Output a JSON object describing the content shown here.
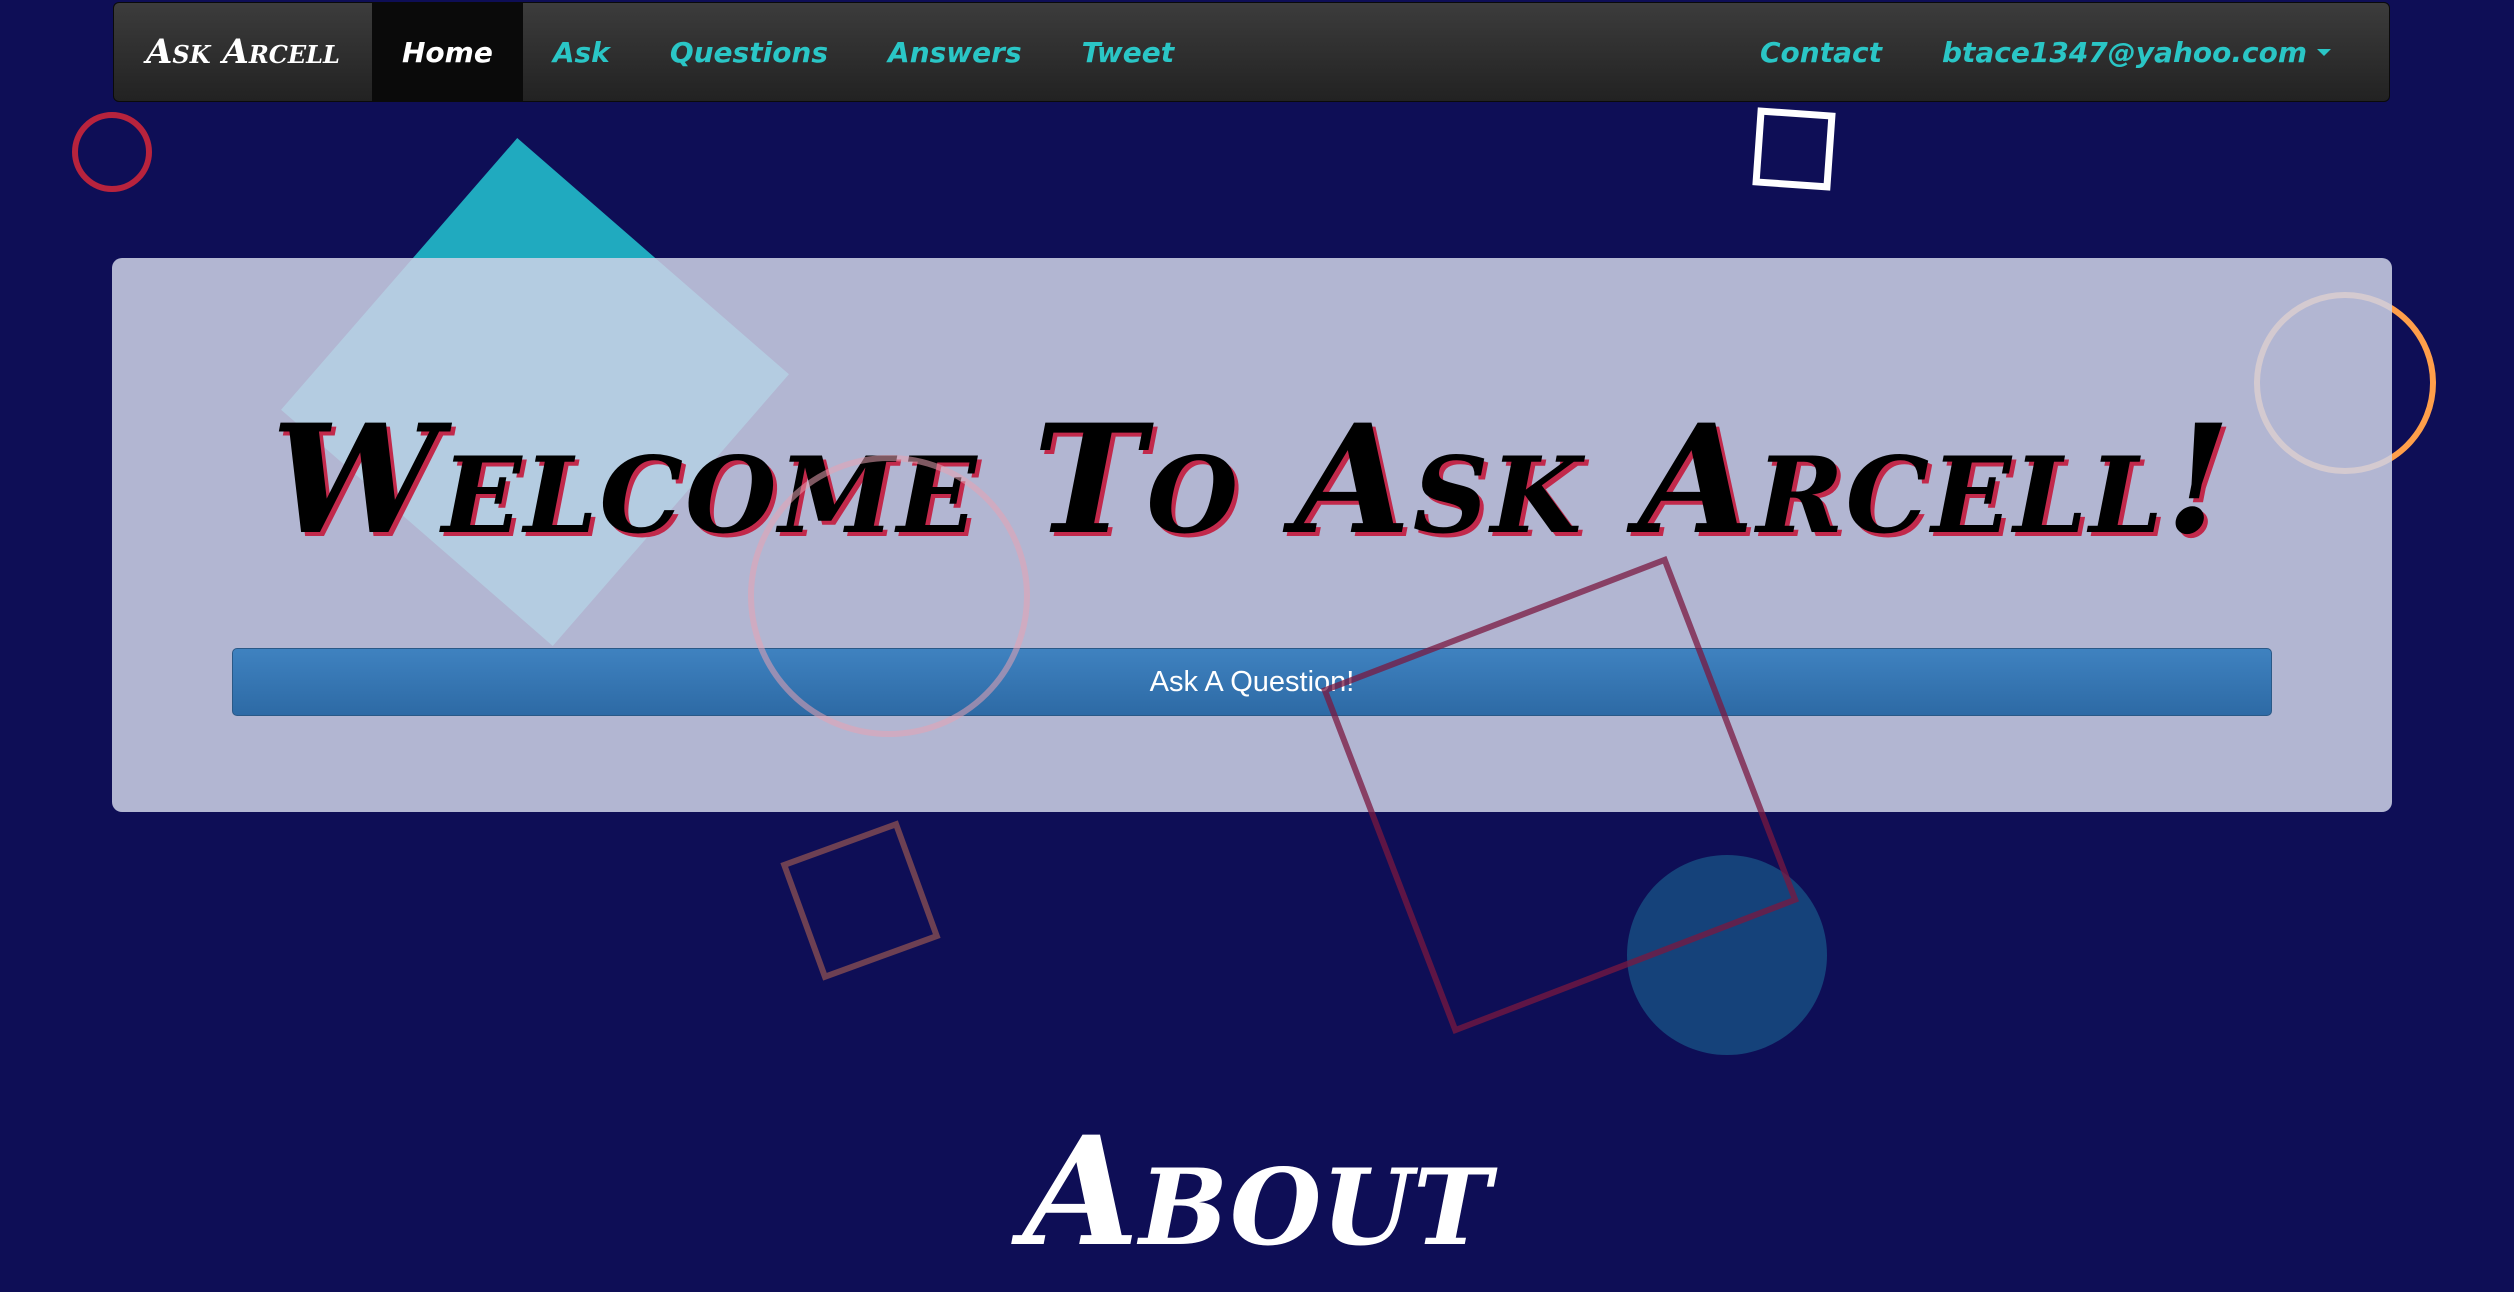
{
  "navbar": {
    "brand": "Ask Arcell",
    "items": [
      {
        "label": "Home",
        "active": true
      },
      {
        "label": "Ask"
      },
      {
        "label": "Questions"
      },
      {
        "label": "Answers"
      },
      {
        "label": "Tweet"
      }
    ],
    "right": {
      "contact": "Contact",
      "user_email": "btace1347@yahoo.com"
    }
  },
  "jumbotron": {
    "title": "Welcome To Ask Arcell!",
    "button_label": "Ask A Question!"
  },
  "about": {
    "heading": "About"
  },
  "colors": {
    "background": "#0e0e56",
    "nav_link": "#2ac6c6",
    "button": "#337ab7",
    "title_shadow": "#c2294b"
  }
}
